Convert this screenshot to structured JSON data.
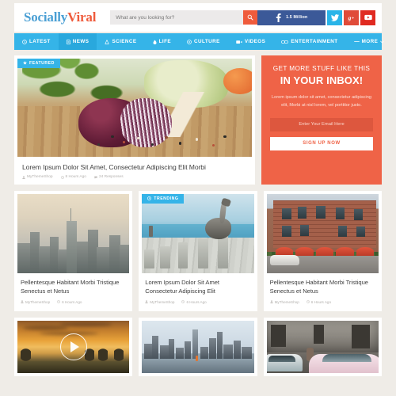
{
  "site": {
    "logo_primary": "Socially",
    "logo_secondary": "Viral"
  },
  "search": {
    "placeholder": "What are you looking for?",
    "value": "",
    "button_icon": "search-icon"
  },
  "social": [
    {
      "name": "facebook",
      "label": "1.5 Million",
      "color": "#3b5998"
    },
    {
      "name": "twitter",
      "label": "",
      "color": "#29b4e8"
    },
    {
      "name": "googleplus",
      "label": "",
      "color": "#e04b39"
    },
    {
      "name": "youtube",
      "label": "",
      "color": "#e02a21"
    }
  ],
  "nav": {
    "items": [
      {
        "label": "LATEST",
        "icon": "clock-icon",
        "active": false
      },
      {
        "label": "NEWS",
        "icon": "document-icon",
        "active": true
      },
      {
        "label": "SCIENCE",
        "icon": "flask-icon",
        "active": false
      },
      {
        "label": "LIFE",
        "icon": "droplet-icon",
        "active": false
      },
      {
        "label": "CULTURE",
        "icon": "globe-icon",
        "active": false
      },
      {
        "label": "VIDEOS",
        "icon": "video-camera-icon",
        "active": false
      },
      {
        "label": "ENTERTAINMENT",
        "icon": "film-icon",
        "active": false
      }
    ],
    "more_label": "MORE",
    "more_icon": "menu-icon"
  },
  "featured": {
    "badge": "FEATURED",
    "badge_icon": "star-icon",
    "title": "Lorem Ipsum Dolor Sit Amet, Consectetur Adipiscing Elit Morbi",
    "meta": {
      "author": "MyThemeShop",
      "time": "8 Hours Ago",
      "responses": "24 Responses"
    }
  },
  "newsletter": {
    "line1": "GET MORE STUFF LIKE THIS",
    "line2": "IN YOUR INBOX!",
    "description": "Lorem ipsum dolor sit amet, consectetur adipiscing elit, Morbi at nisl lorem, vel porttitor justo.",
    "email_placeholder": "Enter Your Email Here",
    "email_value": "",
    "button_label": "SIGN UP NOW",
    "background": "#ef6347"
  },
  "grid": [
    {
      "badge": "",
      "title": "Pellentesque Habitant Morbi Tristique Senectus et Netus",
      "author": "MyThemeShop",
      "time": "6 Hours Ago",
      "image": "nyc-skyline-aerial"
    },
    {
      "badge": "TRENDING",
      "badge_icon": "fire-icon",
      "title": "Lorem Ipsum Dolor Sit Amet Consectetur Adipiscing Elit",
      "author": "MyThemeShop",
      "time": "6 Hours Ago",
      "image": "pelican-on-pier"
    },
    {
      "badge": "",
      "title": "Pellentesque Habitant Morbi Tristique Senectus et Netus",
      "author": "MyThemeShop",
      "time": "6 Hours Ago",
      "image": "brick-building-cafe"
    }
  ],
  "bottom_row": [
    {
      "image": "sunset-field-trees",
      "has_play": true,
      "play_icon": "play-icon"
    },
    {
      "image": "nyc-skyline-water",
      "has_play": false
    },
    {
      "image": "vintage-cars-concrete",
      "has_play": false
    }
  ],
  "colors": {
    "accent_blue": "#35b4e8",
    "accent_orange": "#ef5b3c",
    "page_background": "#efece7"
  }
}
